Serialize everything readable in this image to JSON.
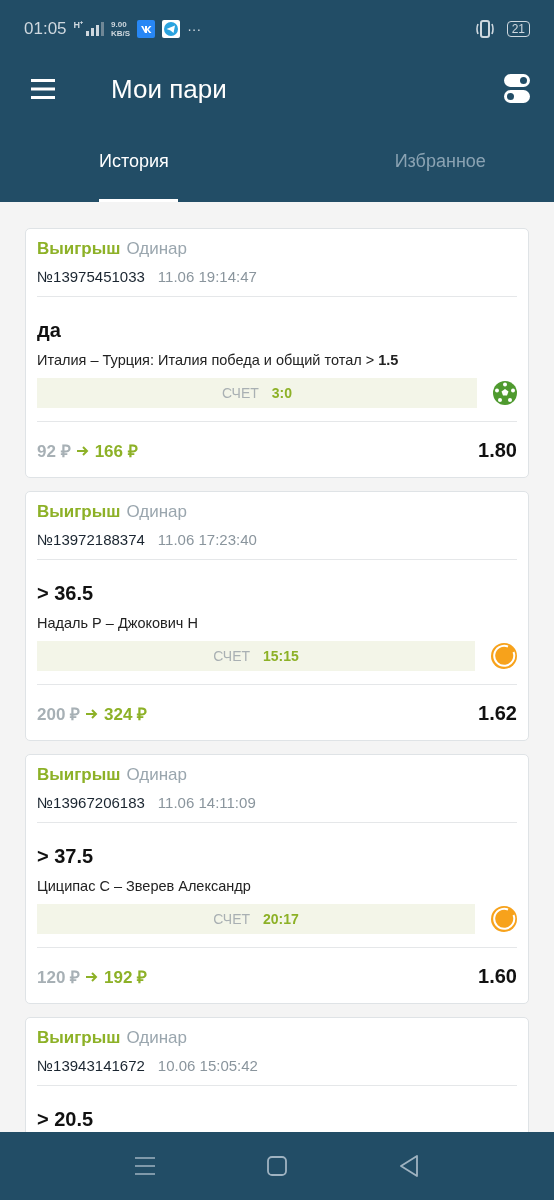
{
  "status_bar": {
    "time": "01:05",
    "network": "H⁺",
    "speed": "9.00",
    "speed_unit": "KB/S",
    "more": "···",
    "battery": "21"
  },
  "app_bar": {
    "title": "Мои пари"
  },
  "tabs": [
    {
      "label": "История",
      "selected": true
    },
    {
      "label": "Избранное",
      "selected": false
    }
  ],
  "bets": [
    {
      "result": "Выигрыш",
      "won": true,
      "type": "Одинар",
      "number": "№13975451033",
      "date": "11.06 19:14:47",
      "pick": "да",
      "event": "Италия – Турция: Италия победа и общий тотал > **1.5**",
      "score_label": "СЧЕТ",
      "score": "3:0",
      "kind": "football",
      "stake": "92 ₽",
      "payout": "166 ₽",
      "odds": "1.80"
    },
    {
      "result": "Выигрыш",
      "won": true,
      "type": "Одинар",
      "number": "№13972188374",
      "date": "11.06 17:23:40",
      "pick": "> 36.5",
      "event": "Надаль Р – Джокович Н",
      "score_label": "СЧЕТ",
      "score": "15:15",
      "kind": "tennis",
      "stake": "200 ₽",
      "payout": "324 ₽",
      "odds": "1.62"
    },
    {
      "result": "Выигрыш",
      "won": true,
      "type": "Одинар",
      "number": "№13967206183",
      "date": "11.06 14:11:09",
      "pick": "> 37.5",
      "event": "Циципас С – Зверев Александр",
      "score_label": "СЧЕТ",
      "score": "20:17",
      "kind": "tennis",
      "stake": "120 ₽",
      "payout": "192 ₽",
      "odds": "1.60"
    },
    {
      "result": "Выигрыш",
      "won": true,
      "type": "Одинар",
      "number": "№13943141672",
      "date": "10.06 15:05:42",
      "pick": "> 20.5"
    }
  ]
}
